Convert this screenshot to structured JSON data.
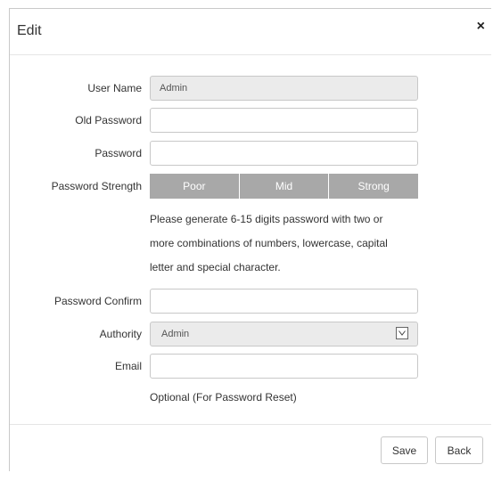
{
  "dialog": {
    "title": "Edit",
    "close_glyph": "×",
    "close_icon": "close-icon"
  },
  "form": {
    "user_name": {
      "label": "User Name",
      "value": "Admin"
    },
    "old_password": {
      "label": "Old Password",
      "value": ""
    },
    "password": {
      "label": "Password",
      "value": ""
    },
    "password_strength": {
      "label": "Password Strength",
      "levels": [
        "Poor",
        "Mid",
        "Strong"
      ],
      "bar_color": "#a8a8a8"
    },
    "hint_lines": [
      "Please generate 6-15 digits password with two or",
      "more combinations of numbers, lowercase, capital",
      "letter and special character."
    ],
    "password_confirm": {
      "label": "Password Confirm",
      "value": ""
    },
    "authority": {
      "label": "Authority",
      "value": "Admin",
      "icon": "chevron-down-icon"
    },
    "email": {
      "label": "Email",
      "value": "",
      "note": "Optional (For Password Reset)"
    }
  },
  "footer": {
    "save_label": "Save",
    "back_label": "Back"
  }
}
